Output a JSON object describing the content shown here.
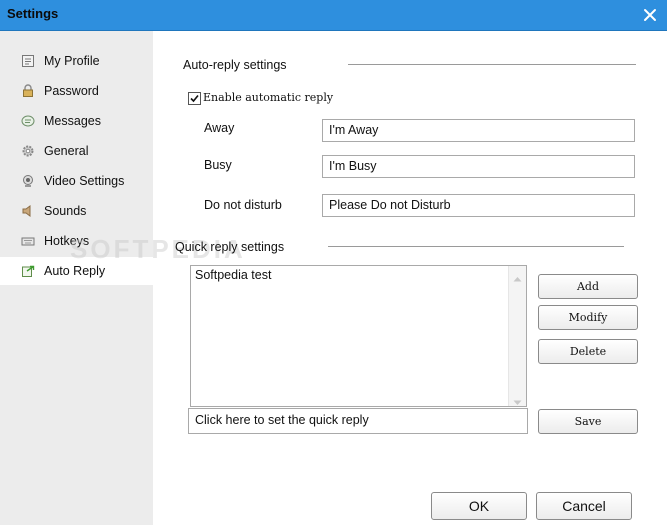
{
  "window": {
    "title": "Settings"
  },
  "sidebar": {
    "items": [
      {
        "label": "My Profile",
        "icon": "profile-card-icon"
      },
      {
        "label": "Password",
        "icon": "lock-icon"
      },
      {
        "label": "Messages",
        "icon": "messages-icon"
      },
      {
        "label": "General",
        "icon": "gear-icon"
      },
      {
        "label": "Video Settings",
        "icon": "webcam-icon"
      },
      {
        "label": "Sounds",
        "icon": "speaker-icon"
      },
      {
        "label": "Hotkeys",
        "icon": "keyboard-icon"
      },
      {
        "label": "Auto Reply",
        "icon": "auto-reply-icon",
        "active": true
      }
    ]
  },
  "watermark": "SOFTPEDIA",
  "auto_reply": {
    "section_title": "Auto-reply settings",
    "enable_label": "Enable automatic reply",
    "enable_checked": true,
    "fields": [
      {
        "label": "Away",
        "value": "I'm Away"
      },
      {
        "label": "Busy",
        "value": "I'm Busy"
      },
      {
        "label": "Do not disturb",
        "value": "Please Do not Disturb"
      }
    ]
  },
  "quick_reply": {
    "section_title": "Quick reply settings",
    "list_text": "Softpedia test",
    "input_placeholder": "Click here to set the quick reply",
    "buttons": {
      "add": "Add",
      "modify": "Modify",
      "delete": "Delete",
      "save": "Save"
    }
  },
  "footer": {
    "ok": "OK",
    "cancel": "Cancel"
  },
  "colors": {
    "titlebar": "#2e8fde",
    "sidebar_bg": "#ececec",
    "active_item_bg": "#ffffff"
  }
}
